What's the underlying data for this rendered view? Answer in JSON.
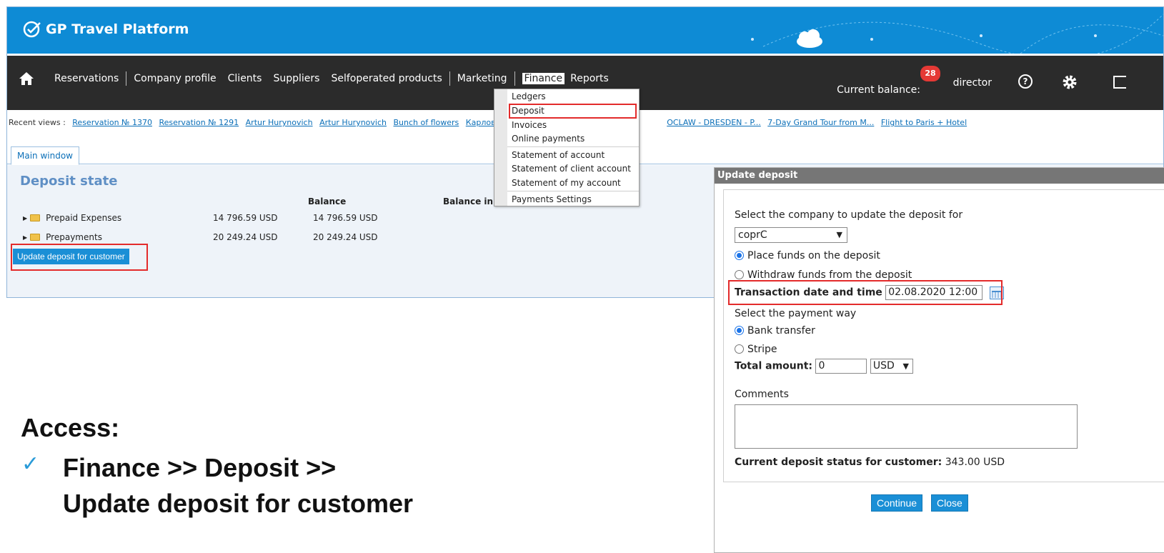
{
  "app": {
    "title": "GP Travel Platform"
  },
  "nav": {
    "items": [
      "Reservations",
      "Company profile",
      "Clients",
      "Suppliers",
      "Selfoperated products",
      "Marketing",
      "Finance",
      "Reports"
    ],
    "current_balance_label": "Current balance:",
    "notification_count": "28",
    "username": "director",
    "help_glyph": "?"
  },
  "recent": {
    "label": "Recent views :",
    "links": [
      "Reservation № 1370",
      "Reservation № 1291",
      "Artur Hurynovich",
      "Artur Hurynovich",
      "Bunch of flowers",
      "КарловыВары",
      "OCLAW - DRESDEN - P...",
      "7-Day Grand Tour from M...",
      "Flight to Paris + Hotel"
    ]
  },
  "tabs": {
    "main": "Main window"
  },
  "deposit": {
    "title": "Deposit state",
    "columns": {
      "balance": "Balance",
      "balance_in": "Balance in th"
    },
    "rows": [
      {
        "name": "Prepaid Expenses",
        "amount": "14 796.59 USD",
        "balance": "14 796.59 USD"
      },
      {
        "name": "Prepayments",
        "amount": "20 249.24 USD",
        "balance": "20 249.24 USD"
      }
    ],
    "update_button": "Update deposit for customer"
  },
  "finance_menu": {
    "items": [
      "Ledgers",
      "Deposit",
      "Invoices",
      "Online payments",
      "Statement of account",
      "Statement of client account",
      "Statement of my account",
      "Payments Settings"
    ],
    "highlighted": "Deposit"
  },
  "dialog": {
    "title": "Update deposit",
    "select_company_label": "Select the company to update the deposit for",
    "company_value": "coprC",
    "place_funds": "Place funds on the deposit",
    "withdraw_funds": "Withdraw funds from the deposit",
    "transaction_label": "Transaction date and time",
    "transaction_value": "02.08.2020 12:00",
    "payment_way_label": "Select the payment way",
    "bank_transfer": "Bank transfer",
    "stripe": "Stripe",
    "total_amount_label": "Total amount:",
    "total_amount_value": "0",
    "currency": "USD",
    "comments_label": "Comments",
    "status_label": "Current deposit status for customer:",
    "status_value": "343.00 USD",
    "continue_button": "Continue",
    "close_button": "Close"
  },
  "access": {
    "heading": "Access:",
    "line1": "Finance >> Deposit >>",
    "line2": "Update deposit for customer"
  },
  "colors": {
    "brand": "#0e8bd5",
    "navbar": "#2b2b2b",
    "highlight": "#e32b2b",
    "button": "#1a8fd6"
  }
}
